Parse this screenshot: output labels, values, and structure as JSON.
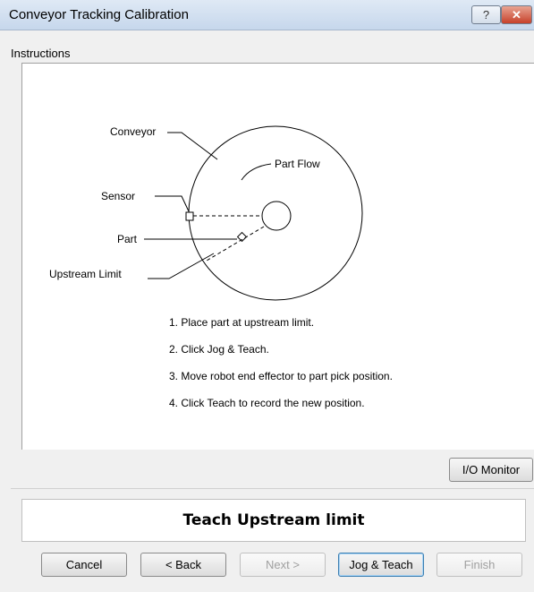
{
  "window": {
    "title": "Conveyor Tracking Calibration",
    "help_label": "?",
    "close_label": "✕"
  },
  "instructions": {
    "group_label": "Instructions",
    "diagram": {
      "conveyor_label": "Conveyor",
      "part_flow_label": "Part Flow",
      "sensor_label": "Sensor",
      "part_label": "Part",
      "upstream_limit_label": "Upstream Limit"
    },
    "steps": [
      "1. Place part at upstream limit.",
      "2. Click Jog & Teach.",
      "3. Move robot end effector to part pick position.",
      "4. Click Teach to record the new position."
    ]
  },
  "io_monitor_label": "I/O Monitor",
  "status_text": "Teach Upstream limit",
  "buttons": {
    "cancel": "Cancel",
    "back": "< Back",
    "next": "Next >",
    "jog_teach": "Jog & Teach",
    "finish": "Finish"
  }
}
